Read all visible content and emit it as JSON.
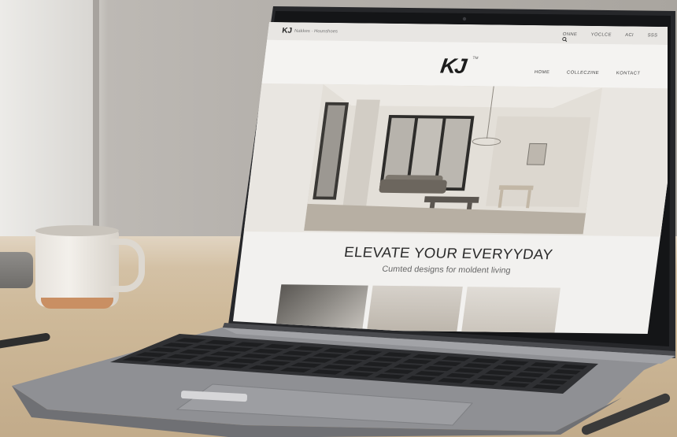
{
  "site": {
    "topbar": {
      "logo": "KJ",
      "mini_text": "Nakkes · Hounshoes",
      "nav": [
        "ONNE",
        "YOCLCE",
        "ACI",
        "SSS"
      ]
    },
    "logo": "KJ",
    "logo_sup": "TM",
    "nav": [
      "HOME",
      "COLLECZINE",
      "KONTACT"
    ],
    "headline": "ELEVATE YOUR EVERYYDAY",
    "subline": "Cumted designs for moldent living"
  },
  "icons": {
    "search": "search-icon"
  },
  "colors": {
    "screen_bg": "#f2f1ef",
    "hero_bg": "#e9e6e1",
    "desk": "#ceb999",
    "wall": "#b3afaa",
    "laptop": "#8a8a8d",
    "keyboard": "#2f3033"
  }
}
